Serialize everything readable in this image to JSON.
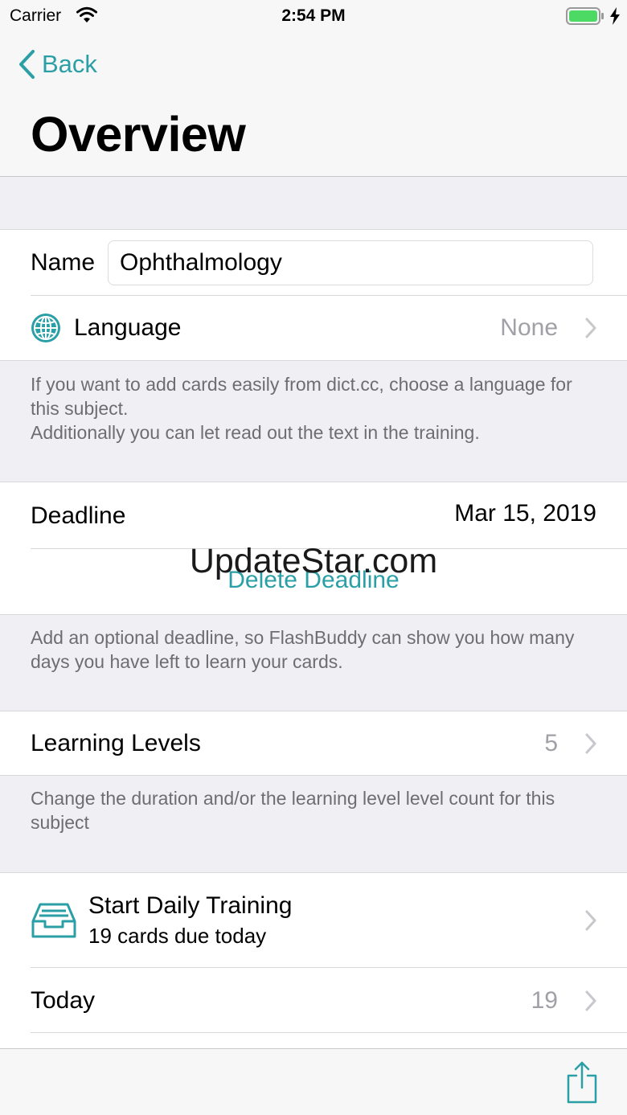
{
  "status_bar": {
    "carrier": "Carrier",
    "time": "2:54 PM"
  },
  "nav": {
    "back_label": "Back",
    "title": "Overview"
  },
  "name_row": {
    "label": "Name",
    "value": "Ophthalmology"
  },
  "language_row": {
    "label": "Language",
    "value": "None"
  },
  "language_footer": "If you want to add cards easily from dict.cc, choose a language for this subject.\nAdditionally you can let read out the text in the training.",
  "deadline_row": {
    "label": "Deadline",
    "value": "Mar 15, 2019"
  },
  "delete_deadline_label": "Delete Deadline",
  "deadline_footer": "Add an optional deadline, so FlashBuddy can show you how many days you have left to learn your cards.",
  "levels_row": {
    "label": "Learning Levels",
    "value": "5"
  },
  "levels_footer": "Change the duration and/or the learning level level count for this subject",
  "training_row": {
    "title": "Start Daily Training",
    "subtitle": "19 cards due today"
  },
  "today_row": {
    "label": "Today",
    "value": "19"
  },
  "watermark": "UpdateStar.com",
  "colors": {
    "accent": "#2b9fa6",
    "battery": "#4cd964",
    "background": "#efeff4"
  }
}
